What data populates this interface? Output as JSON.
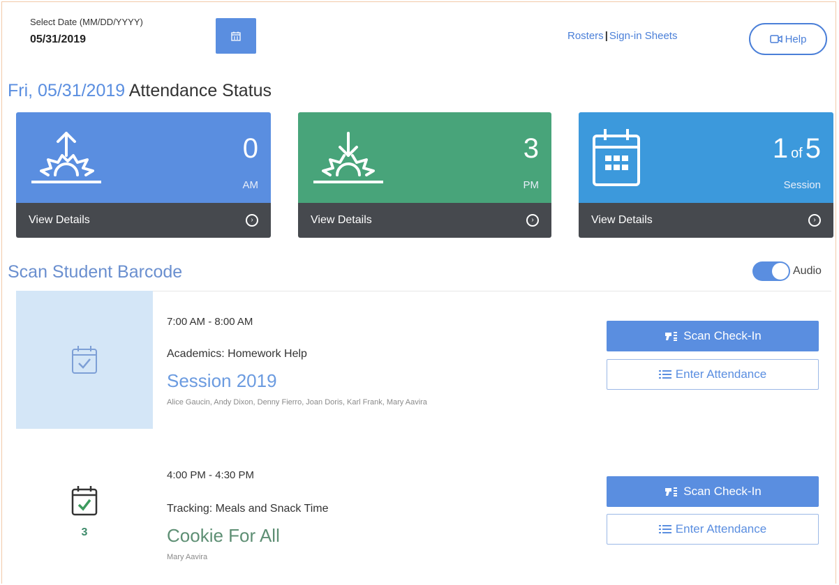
{
  "header": {
    "date_label": "Select Date (MM/DD/YYYY)",
    "date_value": "05/31/2019",
    "calendar_icon": "calendar-icon",
    "rosters_link": "Rosters",
    "sign_in_link": "Sign-in Sheets",
    "separator": "|",
    "help_label": "Help",
    "help_icon": "video-icon"
  },
  "status": {
    "date": "Fri, 05/31/2019",
    "title": "Attendance Status",
    "cards": [
      {
        "value": "0",
        "unit": "AM",
        "details": "View Details",
        "icon": "sunrise-icon",
        "color": "#5a8ee0"
      },
      {
        "value": "3",
        "unit": "PM",
        "details": "View Details",
        "icon": "sunset-icon",
        "color": "#48a47a"
      },
      {
        "value": "1",
        "of": "of",
        "total": "5",
        "unit": "Session",
        "details": "View Details",
        "icon": "calendar-icon",
        "color": "#3c99dc"
      }
    ]
  },
  "scan": {
    "title": "Scan Student Barcode",
    "audio_label": "Audio",
    "audio_on": true
  },
  "sessions": [
    {
      "time": "7:00 AM - 8:00 AM",
      "activity": "Academics: Homework Help",
      "name": "Session 2019",
      "students": "Alice Gaucin, Andy Dixon, Denny Fierro, Joan Doris, Karl Frank, Mary Aavira",
      "scan_label": "Scan Check-In",
      "enter_label": "Enter Attendance",
      "count": "",
      "icon": "calendar-check-icon"
    },
    {
      "time": "4:00 PM - 4:30 PM",
      "activity": "Tracking: Meals and Snack Time",
      "name": "Cookie For All",
      "students": "Mary Aavira",
      "scan_label": "Scan Check-In",
      "enter_label": "Enter Attendance",
      "count": "3",
      "icon": "calendar-check-icon"
    }
  ]
}
